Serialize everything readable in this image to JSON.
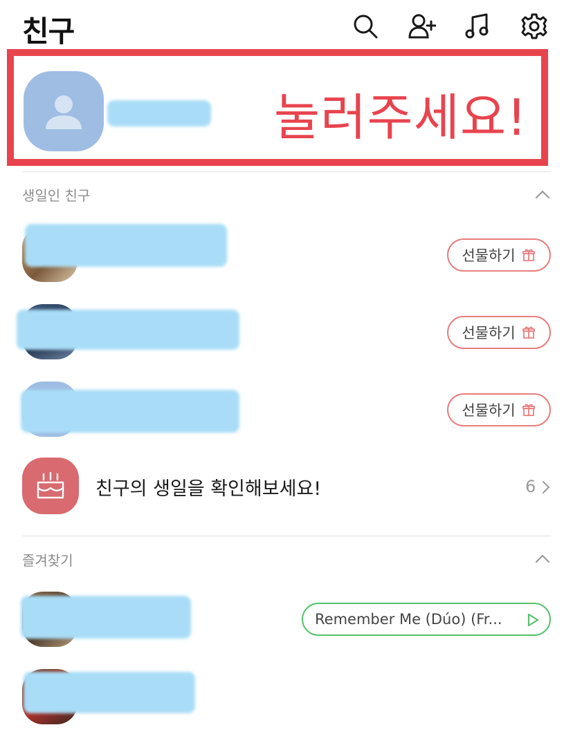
{
  "header": {
    "title": "친구",
    "icons": [
      "search-icon",
      "add-friend-icon",
      "music-icon",
      "settings-icon"
    ]
  },
  "profile": {
    "annotation": "눌러주세요!",
    "annotation_color": "#e8444e"
  },
  "birthday_section": {
    "title": "생일인 친구",
    "gift_label": "선물하기",
    "friends_count": 3
  },
  "birthday_check": {
    "text": "친구의 생일을 확인해보세요!",
    "count": "6"
  },
  "favorites_section": {
    "title": "즐겨찾기",
    "music_label": "Remember Me (Dúo) (Fr..."
  },
  "colors": {
    "accent_red": "#e8444e",
    "gift_border": "#e97d7d",
    "music_border": "#55c26a",
    "redaction": "#a9ddf7"
  }
}
